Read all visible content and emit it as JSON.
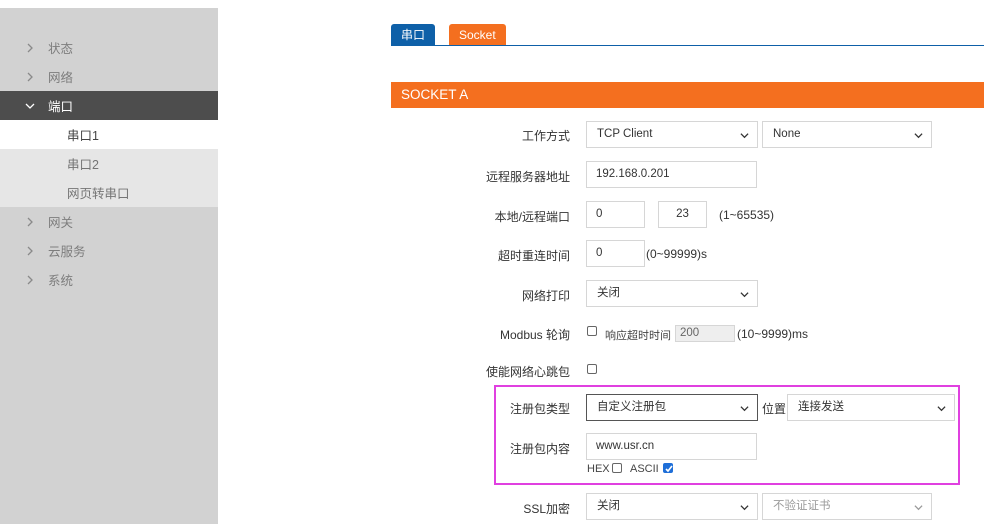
{
  "sidebar": {
    "items": [
      {
        "label": "状态"
      },
      {
        "label": "网络"
      },
      {
        "label": "端口"
      },
      {
        "label": "网关"
      },
      {
        "label": "云服务"
      },
      {
        "label": "系统"
      }
    ],
    "sub_items": [
      {
        "label": "串口1"
      },
      {
        "label": "串口2"
      },
      {
        "label": "网页转串口"
      }
    ]
  },
  "tabs": {
    "serial": "串口",
    "socket": "Socket"
  },
  "section": {
    "title": "SOCKET A"
  },
  "form": {
    "work_mode": {
      "label": "工作方式",
      "value": "TCP Client",
      "secondary": "None"
    },
    "remote_addr": {
      "label": "远程服务器地址",
      "value": "192.168.0.201"
    },
    "ports": {
      "label": "本地/远程端口",
      "local": "0",
      "remote": "23",
      "hint": "(1~65535)"
    },
    "reconnect": {
      "label": "超时重连时间",
      "value": "0",
      "hint": "(0~99999)s"
    },
    "net_print": {
      "label": "网络打印",
      "value": "关闭"
    },
    "modbus": {
      "label": "Modbus 轮询",
      "response_label": "响应超时时间",
      "value": "200",
      "hint": "(10~9999)ms"
    },
    "heartbeat": {
      "label": "使能网络心跳包"
    },
    "reg_type": {
      "label": "注册包类型",
      "value": "自定义注册包",
      "position_label": "位置",
      "position_value": "连接发送"
    },
    "reg_content": {
      "label": "注册包内容",
      "value": "www.usr.cn",
      "hex_label": "HEX",
      "ascii_label": "ASCII"
    },
    "ssl": {
      "label": "SSL加密",
      "value": "关闭",
      "cert_value": "不验证证书"
    }
  },
  "colors": {
    "orange": "#f46f1f",
    "blue": "#0e60a8",
    "highlight": "#e040e0"
  }
}
